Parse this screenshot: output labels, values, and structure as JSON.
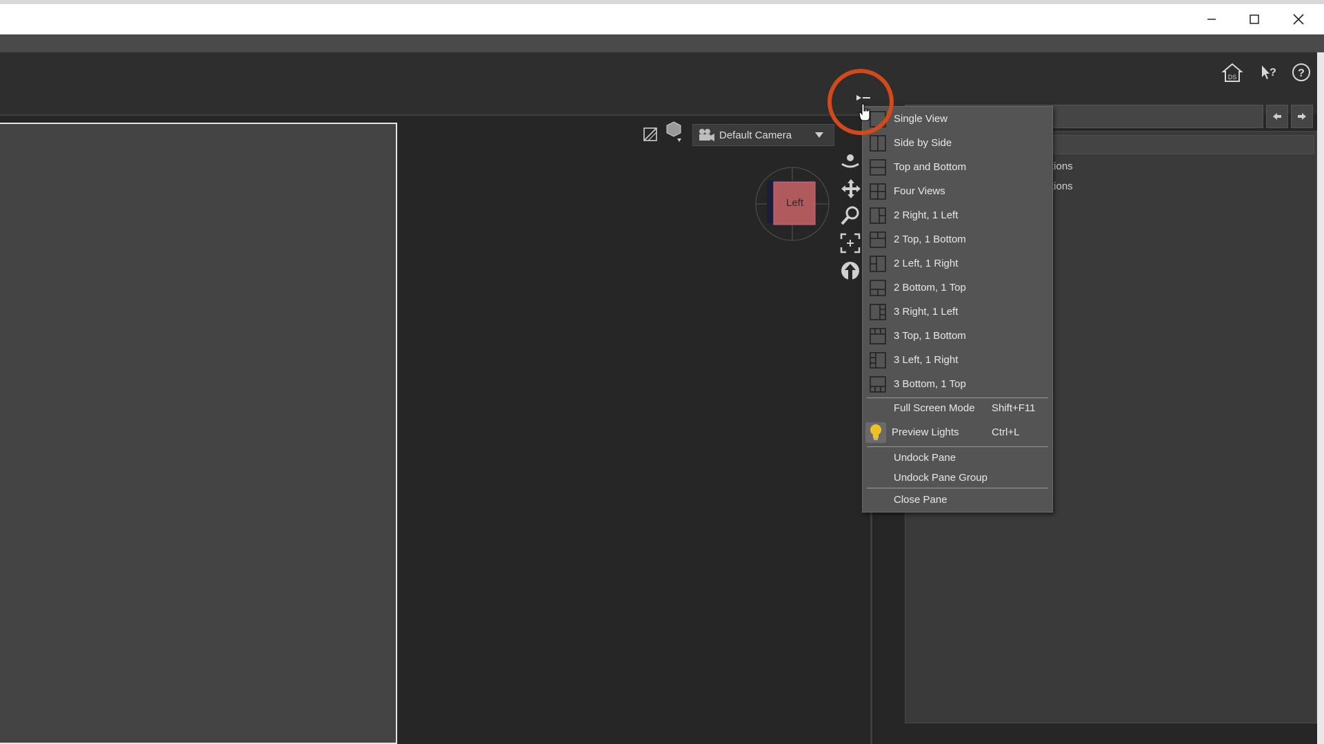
{
  "window_controls": {
    "minimize_icon": "minimize-icon",
    "maximize_icon": "maximize-icon",
    "close_icon": "close-icon"
  },
  "top_icons": [
    "home-ds-icon",
    "whats-this-icon",
    "help-icon"
  ],
  "home_badge": "DS",
  "camera": {
    "label": "Default Camera"
  },
  "cube": {
    "face_label": "Left"
  },
  "panel_rows": [
    "tions",
    "tions"
  ],
  "menu": {
    "items": [
      {
        "label": "Single View",
        "icon": "single-view-icon"
      },
      {
        "label": "Side by Side",
        "icon": "side-by-side-icon"
      },
      {
        "label": "Top and Bottom",
        "icon": "top-bottom-icon"
      },
      {
        "label": "Four Views",
        "icon": "four-views-icon"
      },
      {
        "label": "2 Right, 1 Left",
        "icon": "2right-1left-icon"
      },
      {
        "label": "2 Top, 1 Bottom",
        "icon": "2top-1bottom-icon"
      },
      {
        "label": "2 Left, 1 Right",
        "icon": "2left-1right-icon"
      },
      {
        "label": "2 Bottom, 1 Top",
        "icon": "2bottom-1top-icon"
      },
      {
        "label": "3 Right, 1 Left",
        "icon": "3right-1left-icon"
      },
      {
        "label": "3 Top, 1 Bottom",
        "icon": "3top-1bottom-icon"
      },
      {
        "label": "3 Left, 1 Right",
        "icon": "3left-1right-icon"
      },
      {
        "label": "3 Bottom, 1 Top",
        "icon": "3bottom-1top-icon"
      }
    ],
    "full_screen": {
      "label": "Full Screen Mode",
      "shortcut": "Shift+F11"
    },
    "preview_lights": {
      "label": "Preview Lights",
      "shortcut": "Ctrl+L",
      "icon": "lightbulb-icon"
    },
    "undock_pane": "Undock Pane",
    "undock_pane_group": "Undock Pane Group",
    "close_pane": "Close Pane"
  },
  "colors": {
    "accent_ring": "#d24a1a",
    "menu_bg": "#545454",
    "viewport_bg": "#444444",
    "app_bg": "#262626"
  }
}
